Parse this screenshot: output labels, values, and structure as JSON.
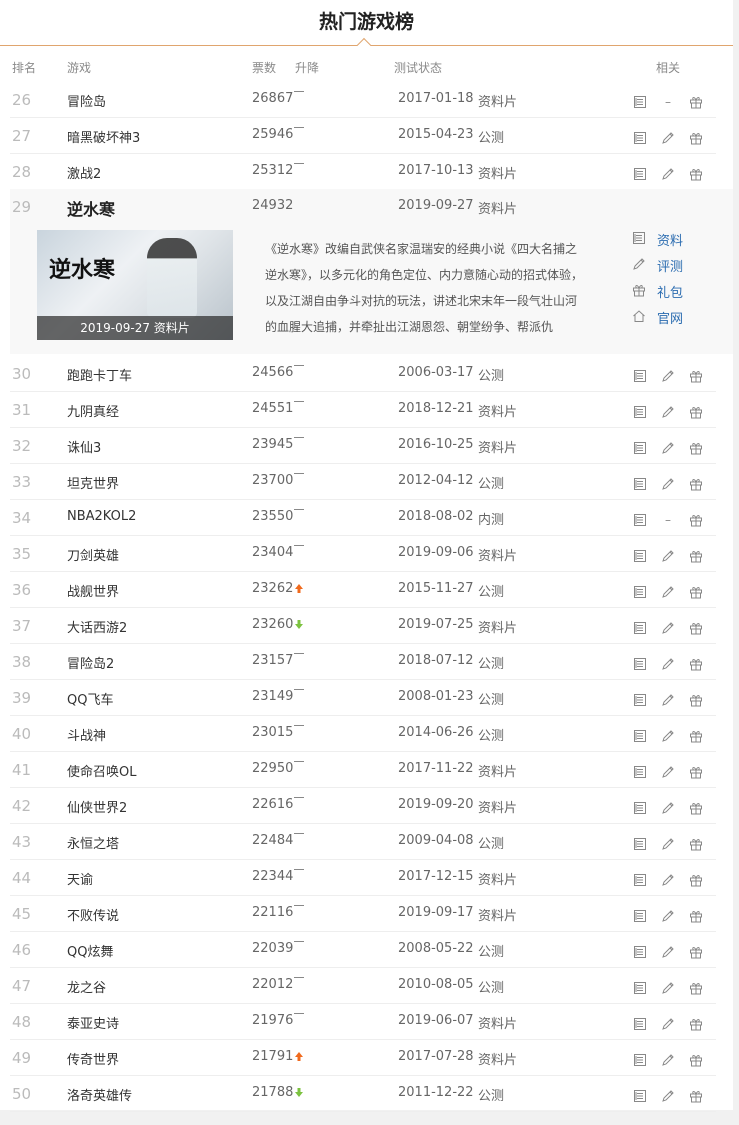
{
  "title": "热门游戏榜",
  "headers": {
    "rank": "排名",
    "game": "游戏",
    "votes": "票数",
    "change": "升降",
    "status": "测试状态",
    "related": "相关"
  },
  "expanded": {
    "rank": "29",
    "name": "逆水寒",
    "votes": "24932",
    "date": "2019-09-27",
    "status": "资料片",
    "cover_logo": "逆水寒",
    "cover_caption": "2019-09-27 资料片",
    "description": "《逆水寒》改编自武侠名家温瑞安的经典小说《四大名捕之逆水寒》，以多元化的角色定位、内力意随心动的招式体验，以及江湖自由争斗对抗的玩法，讲述北宋末年一段气壮山河的血腥大追捕，并牵扯出江湖恩怨、朝堂纷争、帮派仇",
    "links": [
      {
        "label": "资料",
        "icon": "document-icon"
      },
      {
        "label": "评测",
        "icon": "pencil-icon"
      },
      {
        "label": "礼包",
        "icon": "gift-icon"
      },
      {
        "label": "官网",
        "icon": "home-icon"
      }
    ]
  },
  "rows": [
    {
      "rank": "26",
      "name": "冒险岛",
      "votes": "26867",
      "trend": "flat",
      "date": "2017-01-18",
      "status": "资料片",
      "review": false
    },
    {
      "rank": "27",
      "name": "暗黑破坏神3",
      "votes": "25946",
      "trend": "flat",
      "date": "2015-04-23",
      "status": "公测",
      "review": true
    },
    {
      "rank": "28",
      "name": "激战2",
      "votes": "25312",
      "trend": "flat",
      "date": "2017-10-13",
      "status": "资料片",
      "review": true
    },
    {
      "rank": "30",
      "name": "跑跑卡丁车",
      "votes": "24566",
      "trend": "flat",
      "date": "2006-03-17",
      "status": "公测",
      "review": true
    },
    {
      "rank": "31",
      "name": "九阴真经",
      "votes": "24551",
      "trend": "flat",
      "date": "2018-12-21",
      "status": "资料片",
      "review": true
    },
    {
      "rank": "32",
      "name": "诛仙3",
      "votes": "23945",
      "trend": "flat",
      "date": "2016-10-25",
      "status": "资料片",
      "review": true
    },
    {
      "rank": "33",
      "name": "坦克世界",
      "votes": "23700",
      "trend": "flat",
      "date": "2012-04-12",
      "status": "公测",
      "review": true
    },
    {
      "rank": "34",
      "name": "NBA2KOL2",
      "votes": "23550",
      "trend": "flat",
      "date": "2018-08-02",
      "status": "内测",
      "review": false
    },
    {
      "rank": "35",
      "name": "刀剑英雄",
      "votes": "23404",
      "trend": "flat",
      "date": "2019-09-06",
      "status": "资料片",
      "review": true
    },
    {
      "rank": "36",
      "name": "战舰世界",
      "votes": "23262",
      "trend": "up",
      "date": "2015-11-27",
      "status": "公测",
      "review": true
    },
    {
      "rank": "37",
      "name": "大话西游2",
      "votes": "23260",
      "trend": "down",
      "date": "2019-07-25",
      "status": "资料片",
      "review": true
    },
    {
      "rank": "38",
      "name": "冒险岛2",
      "votes": "23157",
      "trend": "flat",
      "date": "2018-07-12",
      "status": "公测",
      "review": true
    },
    {
      "rank": "39",
      "name": "QQ飞车",
      "votes": "23149",
      "trend": "flat",
      "date": "2008-01-23",
      "status": "公测",
      "review": true
    },
    {
      "rank": "40",
      "name": "斗战神",
      "votes": "23015",
      "trend": "flat",
      "date": "2014-06-26",
      "status": "公测",
      "review": true
    },
    {
      "rank": "41",
      "name": "使命召唤OL",
      "votes": "22950",
      "trend": "flat",
      "date": "2017-11-22",
      "status": "资料片",
      "review": true
    },
    {
      "rank": "42",
      "name": "仙侠世界2",
      "votes": "22616",
      "trend": "flat",
      "date": "2019-09-20",
      "status": "资料片",
      "review": true
    },
    {
      "rank": "43",
      "name": "永恒之塔",
      "votes": "22484",
      "trend": "flat",
      "date": "2009-04-08",
      "status": "公测",
      "review": true
    },
    {
      "rank": "44",
      "name": "天谕",
      "votes": "22344",
      "trend": "flat",
      "date": "2017-12-15",
      "status": "资料片",
      "review": true
    },
    {
      "rank": "45",
      "name": "不败传说",
      "votes": "22116",
      "trend": "flat",
      "date": "2019-09-17",
      "status": "资料片",
      "review": true
    },
    {
      "rank": "46",
      "name": "QQ炫舞",
      "votes": "22039",
      "trend": "flat",
      "date": "2008-05-22",
      "status": "公测",
      "review": true
    },
    {
      "rank": "47",
      "name": "龙之谷",
      "votes": "22012",
      "trend": "flat",
      "date": "2010-08-05",
      "status": "公测",
      "review": true
    },
    {
      "rank": "48",
      "name": "泰亚史诗",
      "votes": "21976",
      "trend": "flat",
      "date": "2019-06-07",
      "status": "资料片",
      "review": true
    },
    {
      "rank": "49",
      "name": "传奇世界",
      "votes": "21791",
      "trend": "up",
      "date": "2017-07-28",
      "status": "资料片",
      "review": true
    },
    {
      "rank": "50",
      "name": "洛奇英雄传",
      "votes": "21788",
      "trend": "down",
      "date": "2011-12-22",
      "status": "公测",
      "review": true
    }
  ],
  "no_review_mark": "–",
  "colors": {
    "accent_line": "#e0a56e",
    "trend_up": "#f06a1d",
    "trend_down": "#7cc240",
    "link": "#2b6cb0"
  }
}
